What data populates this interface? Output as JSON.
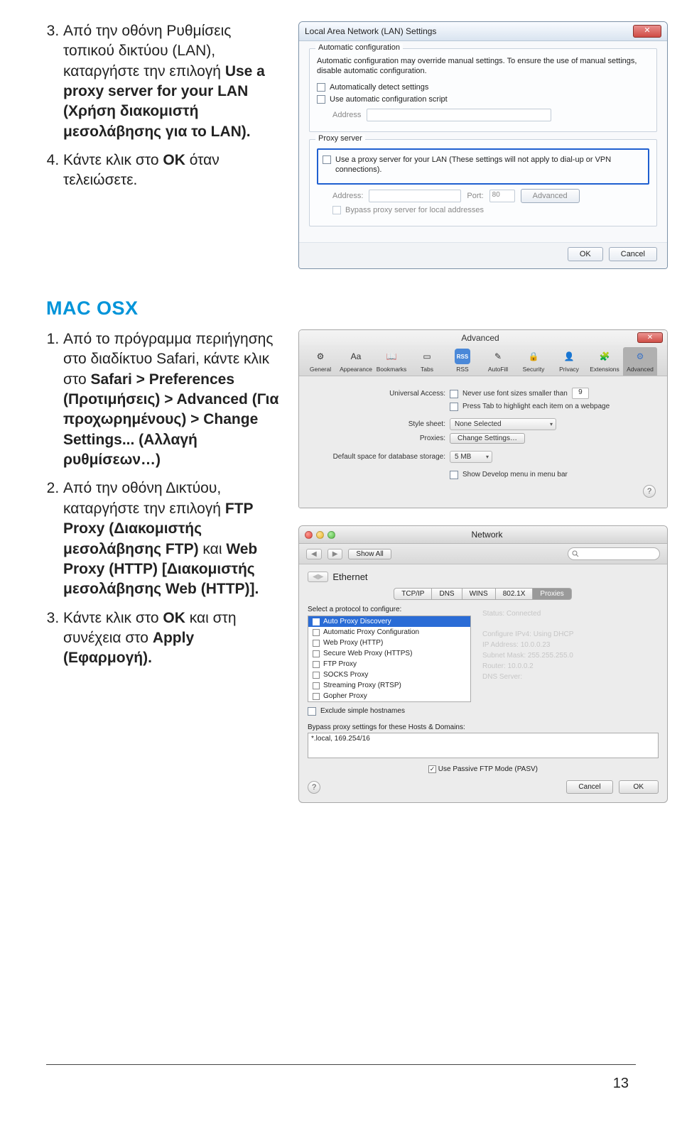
{
  "instr1": {
    "step3": {
      "n": "3.",
      "a": "Από την οθόνη Ρυθμίσεις τοπικού δικτύου (LAN), καταργήστε την επιλογή ",
      "b": "Use a proxy server for your LAN (Χρήση διακομιστή μεσολάβησης για το LAN).",
      "c": ""
    },
    "step4": {
      "n": "4.",
      "a": "Κάντε κλικ στο ",
      "b": "OK",
      "c": " όταν τελειώσετε."
    }
  },
  "macosx_heading": "MAC OSX",
  "instr2": {
    "step1": {
      "n": "1.",
      "a": "Από το πρόγραμμα περιήγησης στο διαδίκτυο Safari, κάντε κλικ στο ",
      "b": "Safari > Preferences (Προτιμήσεις) > Advanced (Για προχωρημένους) > Change Settings... (Αλλαγή ρυθμίσεων…)"
    },
    "step2": {
      "n": "2.",
      "a": "Από την οθόνη Δικτύου, καταργήστε την επιλογή ",
      "b": "FTP Proxy (Διακομιστής μεσολάβησης FTP)",
      "c": " και ",
      "d": "Web Proxy (HTTP) [Διακομιστής μεσολάβησης Web (HTTP)]."
    },
    "step3": {
      "n": "3.",
      "a": "Κάντε κλικ στο ",
      "b": "OK",
      "c": " και στη συνέχεια στο ",
      "d": "Apply (Εφαρμογή)."
    }
  },
  "wind": {
    "title": "Local Area Network (LAN) Settings",
    "close": "✕",
    "auto": {
      "legend": "Automatic configuration",
      "desc": "Automatic configuration may override manual settings. To ensure the use of manual settings, disable automatic configuration.",
      "chk1": "Automatically detect settings",
      "chk2": "Use automatic configuration script",
      "addr": "Address"
    },
    "proxy": {
      "legend": "Proxy server",
      "chk": "Use a proxy server for your LAN (These settings will not apply to dial-up or VPN connections).",
      "addr": "Address:",
      "port": "Port:",
      "portval": "80",
      "adv": "Advanced",
      "bypass": "Bypass proxy server for local addresses"
    },
    "ok": "OK",
    "cancel": "Cancel"
  },
  "saf": {
    "title": "Advanced",
    "tabs": [
      "General",
      "Appearance",
      "Bookmarks",
      "Tabs",
      "RSS",
      "AutoFill",
      "Security",
      "Privacy",
      "Extensions",
      "Advanced"
    ],
    "ua_label": "Universal Access:",
    "ua_chk": "Never use font sizes smaller than",
    "ua_val": "9",
    "ua_chk2": "Press Tab to highlight each item on a webpage",
    "ss_label": "Style sheet:",
    "ss_val": "None Selected",
    "px_label": "Proxies:",
    "px_btn": "Change Settings…",
    "db_label": "Default space for database storage:",
    "db_val": "5 MB",
    "dev_chk": "Show Develop menu in menu bar",
    "q": "?"
  },
  "net": {
    "title": "Network",
    "nav": {
      "back": "◀",
      "fwd": "▶",
      "showall": "Show All"
    },
    "eth_back": "◀▶",
    "eth": "Ethernet",
    "tabs": [
      "TCP/IP",
      "DNS",
      "WINS",
      "802.1X",
      "Proxies"
    ],
    "select_label": "Select a protocol to configure:",
    "protocols": [
      "Auto Proxy Discovery",
      "Automatic Proxy Configuration",
      "Web Proxy (HTTP)",
      "Secure Web Proxy (HTTPS)",
      "FTP Proxy",
      "SOCKS Proxy",
      "Streaming Proxy (RTSP)",
      "Gopher Proxy"
    ],
    "ghost": {
      "status": "Status:  Connected",
      "config": "Configure IPv4:  Using DHCP",
      "ip": "IP Address:  10.0.0.23",
      "mask": "Subnet Mask:  255.255.255.0",
      "router": "Router:  10.0.0.2",
      "dns": "DNS Server:"
    },
    "exclude": "Exclude simple hostnames",
    "bypass_label": "Bypass proxy settings for these Hosts & Domains:",
    "bypass_val": "*.local, 169.254/16",
    "pasv": "Use Passive FTP Mode (PASV)",
    "pasv_chk": "✓",
    "q": "?",
    "cancel": "Cancel",
    "ok": "OK"
  },
  "page_num": "13"
}
